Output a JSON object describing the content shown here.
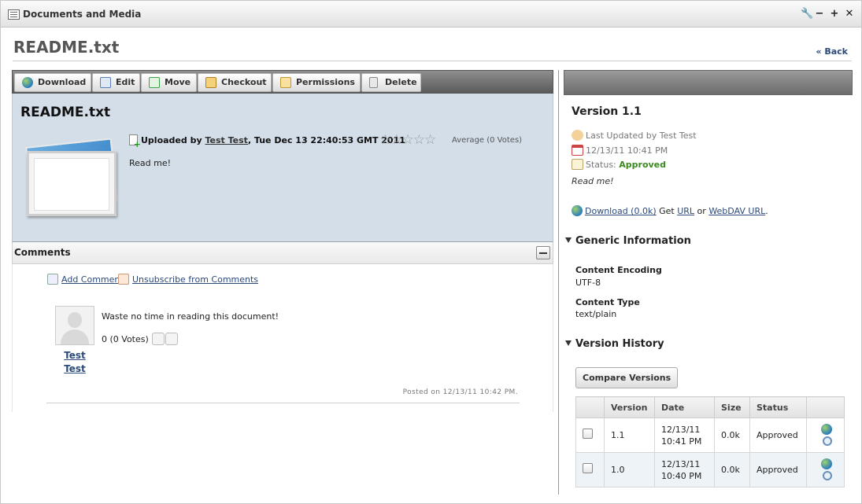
{
  "portlet": {
    "title": "Documents and Media",
    "controls": [
      "🔧",
      "−",
      "+",
      "✕"
    ]
  },
  "page": {
    "title": "README.txt",
    "back_label": "« Back"
  },
  "toolbar": {
    "buttons": [
      {
        "label": "Download",
        "icon": "globe-icon",
        "color": "#3a8fd6"
      },
      {
        "label": "Edit",
        "icon": "edit-icon",
        "color": "#5b7fb5"
      },
      {
        "label": "Move",
        "icon": "move-icon",
        "color": "#3aa34a"
      },
      {
        "label": "Checkout",
        "icon": "lock-icon",
        "color": "#d9a12a"
      },
      {
        "label": "Permissions",
        "icon": "key-icon",
        "color": "#e0b24a"
      },
      {
        "label": "Delete",
        "icon": "trash-icon",
        "color": "#999999"
      }
    ]
  },
  "file": {
    "name": "README.txt",
    "uploaded_prefix": "Uploaded by ",
    "uploader": "Test Test",
    "uploaded_date": ", Tue Dec 13 22:40:53 GMT 2011",
    "stars": "☆☆☆☆☆",
    "rating": "Average (0 Votes)",
    "description": "Read me!"
  },
  "comments": {
    "title": "Comments",
    "add_label": "Add Comment",
    "unsubscribe_label": "Unsubscribe from Comments",
    "items": [
      {
        "author_first": "Test",
        "author_last": "Test",
        "text": "Waste no time in reading this document!",
        "votes": "0 (0 Votes)",
        "posted": "Posted on 12/13/11 10:42 PM."
      }
    ]
  },
  "version": {
    "title": "Version 1.1",
    "last_updated": "Last Updated by Test Test",
    "date": "12/13/11 10:41 PM",
    "status_label": "Status:",
    "status_value": "Approved",
    "description": "Read me!",
    "download_label": "Download (0.0k)",
    "get_text": " Get ",
    "url_label": "URL",
    "or_text": " or ",
    "webdav_label": "WebDAV URL",
    "period": "."
  },
  "generic_info": {
    "title": "Generic Information",
    "encoding_label": "Content Encoding",
    "encoding_value": "UTF-8",
    "type_label": "Content Type",
    "type_value": "text/plain"
  },
  "history": {
    "title": "Version History",
    "compare_label": "Compare Versions",
    "columns": [
      "",
      "Version",
      "Date",
      "Size",
      "Status",
      ""
    ],
    "rows": [
      {
        "version": "1.1",
        "date_line1": "12/13/11",
        "date_line2": "10:41 PM",
        "size": "0.0k",
        "status": "Approved"
      },
      {
        "version": "1.0",
        "date_line1": "12/13/11",
        "date_line2": "10:40 PM",
        "size": "0.0k",
        "status": "Approved"
      }
    ]
  }
}
